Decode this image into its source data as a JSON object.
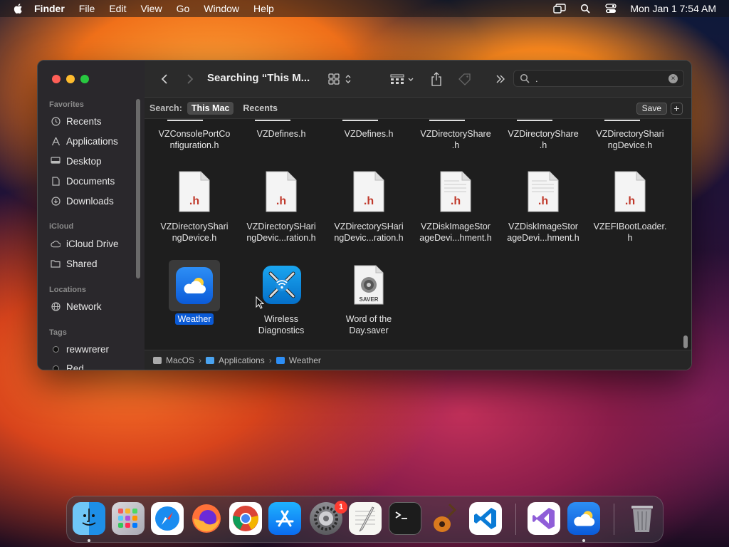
{
  "menubar": {
    "app_name": "Finder",
    "items": [
      "File",
      "Edit",
      "View",
      "Go",
      "Window",
      "Help"
    ],
    "clock": "Mon Jan 1  7:54 AM"
  },
  "window": {
    "title": "Searching “This M...",
    "search_value": ".",
    "scope": {
      "label": "Search:",
      "this_mac": "This Mac",
      "recents": "Recents",
      "save": "Save",
      "add": "+"
    },
    "sidebar": {
      "favorites_header": "Favorites",
      "favorites": [
        {
          "label": "Recents",
          "icon": "clock-icon"
        },
        {
          "label": "Applications",
          "icon": "applications-icon"
        },
        {
          "label": "Desktop",
          "icon": "desktop-icon"
        },
        {
          "label": "Documents",
          "icon": "document-icon"
        },
        {
          "label": "Downloads",
          "icon": "download-icon"
        }
      ],
      "icloud_header": "iCloud",
      "icloud": [
        {
          "label": "iCloud Drive",
          "icon": "cloud-icon"
        },
        {
          "label": "Shared",
          "icon": "shared-folder-icon"
        }
      ],
      "locations_header": "Locations",
      "locations": [
        {
          "label": "Network",
          "icon": "globe-icon"
        }
      ],
      "tags_header": "Tags",
      "tags": [
        {
          "label": "rewwrerer"
        },
        {
          "label": "Red"
        }
      ]
    },
    "files_row1": [
      {
        "name": "VZConsolePortConfiguration.h",
        "line1": "VZConsolePortCo",
        "line2": "nfiguration.h"
      },
      {
        "name": "VZDefines.h",
        "line1": "VZDefines.h",
        "line2": ""
      },
      {
        "name": "VZDefines.h",
        "line1": "VZDefines.h",
        "line2": ""
      },
      {
        "name": "VZDirectoryShare.h",
        "line1": "VZDirectoryShare",
        "line2": ".h"
      },
      {
        "name": "VZDirectoryShare.h",
        "line1": "VZDirectoryShare",
        "line2": ".h"
      },
      {
        "name": "VZDirectorySharingDevice.h",
        "line1": "VZDirectoryShari",
        "line2": "ngDevice.h"
      }
    ],
    "files_row2": [
      {
        "line1": "VZDirectoryShari",
        "line2": "ngDevice.h",
        "ext": ".h"
      },
      {
        "line1": "VZDirectorySHari",
        "line2": "ngDevic...ration.h",
        "ext": ".h"
      },
      {
        "line1": "VZDirectorySHari",
        "line2": "ngDevic...ration.h",
        "ext": ".h"
      },
      {
        "line1": "VZDiskImageStor",
        "line2": "ageDevi...hment.h",
        "ext": ".h"
      },
      {
        "line1": "VZDiskImageStor",
        "line2": "ageDevi...hment.h",
        "ext": ".h"
      },
      {
        "line1": "VZEFIBootLoader.",
        "line2": "h",
        "ext": ".h"
      }
    ],
    "files_row3": [
      {
        "line1": "Weather",
        "line2": ""
      },
      {
        "line1": "Wireless",
        "line2": "Diagnostics"
      },
      {
        "line1": "Word of the",
        "line2": "Day.saver",
        "badge": "SAVER"
      }
    ],
    "pathbar": [
      "MacOS",
      "Applications",
      "Weather"
    ]
  },
  "dock": {
    "apps": [
      "Finder",
      "Launchpad",
      "Safari",
      "Firefox",
      "Chrome",
      "App Store",
      "System Settings",
      "TextEdit",
      "Terminal",
      "GarageBand",
      "Visual Studio Code",
      "Visual Studio",
      "Weather",
      "Trash"
    ],
    "settings_badge": "1"
  }
}
